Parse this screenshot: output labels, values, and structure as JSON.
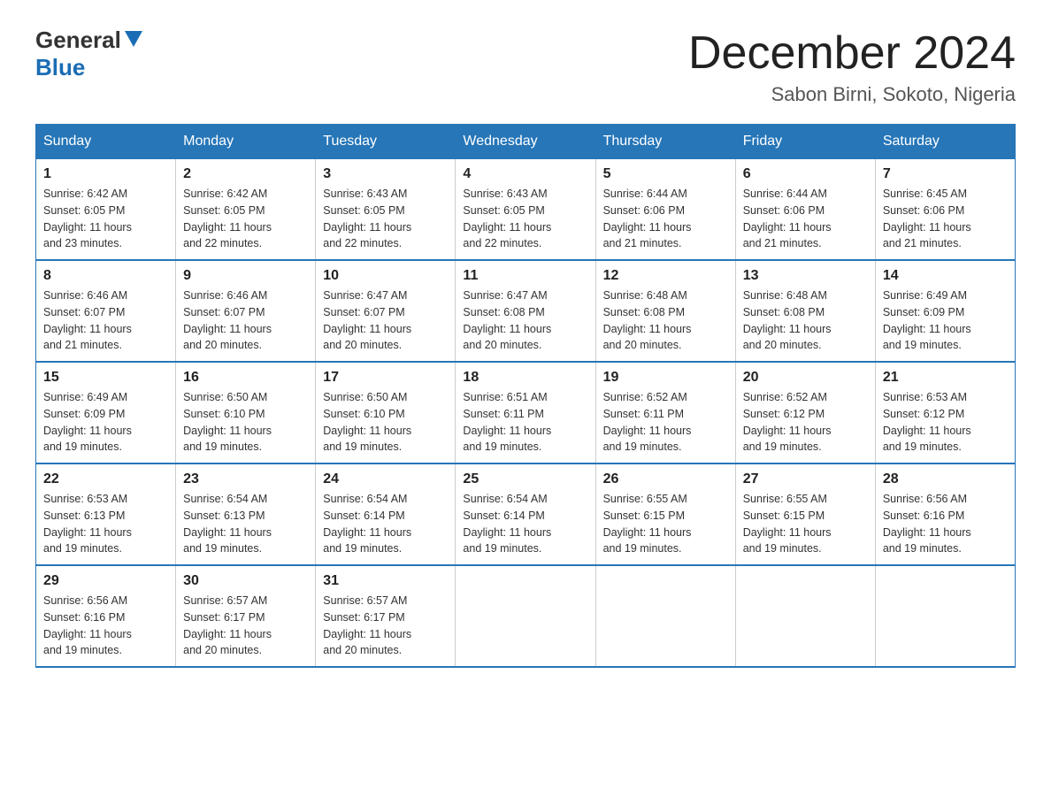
{
  "header": {
    "logo_general": "General",
    "logo_blue": "Blue",
    "month_title": "December 2024",
    "location": "Sabon Birni, Sokoto, Nigeria"
  },
  "weekdays": [
    "Sunday",
    "Monday",
    "Tuesday",
    "Wednesday",
    "Thursday",
    "Friday",
    "Saturday"
  ],
  "weeks": [
    [
      {
        "day": "1",
        "sunrise": "6:42 AM",
        "sunset": "6:05 PM",
        "daylight": "11 hours and 23 minutes."
      },
      {
        "day": "2",
        "sunrise": "6:42 AM",
        "sunset": "6:05 PM",
        "daylight": "11 hours and 22 minutes."
      },
      {
        "day": "3",
        "sunrise": "6:43 AM",
        "sunset": "6:05 PM",
        "daylight": "11 hours and 22 minutes."
      },
      {
        "day": "4",
        "sunrise": "6:43 AM",
        "sunset": "6:05 PM",
        "daylight": "11 hours and 22 minutes."
      },
      {
        "day": "5",
        "sunrise": "6:44 AM",
        "sunset": "6:06 PM",
        "daylight": "11 hours and 21 minutes."
      },
      {
        "day": "6",
        "sunrise": "6:44 AM",
        "sunset": "6:06 PM",
        "daylight": "11 hours and 21 minutes."
      },
      {
        "day": "7",
        "sunrise": "6:45 AM",
        "sunset": "6:06 PM",
        "daylight": "11 hours and 21 minutes."
      }
    ],
    [
      {
        "day": "8",
        "sunrise": "6:46 AM",
        "sunset": "6:07 PM",
        "daylight": "11 hours and 21 minutes."
      },
      {
        "day": "9",
        "sunrise": "6:46 AM",
        "sunset": "6:07 PM",
        "daylight": "11 hours and 20 minutes."
      },
      {
        "day": "10",
        "sunrise": "6:47 AM",
        "sunset": "6:07 PM",
        "daylight": "11 hours and 20 minutes."
      },
      {
        "day": "11",
        "sunrise": "6:47 AM",
        "sunset": "6:08 PM",
        "daylight": "11 hours and 20 minutes."
      },
      {
        "day": "12",
        "sunrise": "6:48 AM",
        "sunset": "6:08 PM",
        "daylight": "11 hours and 20 minutes."
      },
      {
        "day": "13",
        "sunrise": "6:48 AM",
        "sunset": "6:08 PM",
        "daylight": "11 hours and 20 minutes."
      },
      {
        "day": "14",
        "sunrise": "6:49 AM",
        "sunset": "6:09 PM",
        "daylight": "11 hours and 19 minutes."
      }
    ],
    [
      {
        "day": "15",
        "sunrise": "6:49 AM",
        "sunset": "6:09 PM",
        "daylight": "11 hours and 19 minutes."
      },
      {
        "day": "16",
        "sunrise": "6:50 AM",
        "sunset": "6:10 PM",
        "daylight": "11 hours and 19 minutes."
      },
      {
        "day": "17",
        "sunrise": "6:50 AM",
        "sunset": "6:10 PM",
        "daylight": "11 hours and 19 minutes."
      },
      {
        "day": "18",
        "sunrise": "6:51 AM",
        "sunset": "6:11 PM",
        "daylight": "11 hours and 19 minutes."
      },
      {
        "day": "19",
        "sunrise": "6:52 AM",
        "sunset": "6:11 PM",
        "daylight": "11 hours and 19 minutes."
      },
      {
        "day": "20",
        "sunrise": "6:52 AM",
        "sunset": "6:12 PM",
        "daylight": "11 hours and 19 minutes."
      },
      {
        "day": "21",
        "sunrise": "6:53 AM",
        "sunset": "6:12 PM",
        "daylight": "11 hours and 19 minutes."
      }
    ],
    [
      {
        "day": "22",
        "sunrise": "6:53 AM",
        "sunset": "6:13 PM",
        "daylight": "11 hours and 19 minutes."
      },
      {
        "day": "23",
        "sunrise": "6:54 AM",
        "sunset": "6:13 PM",
        "daylight": "11 hours and 19 minutes."
      },
      {
        "day": "24",
        "sunrise": "6:54 AM",
        "sunset": "6:14 PM",
        "daylight": "11 hours and 19 minutes."
      },
      {
        "day": "25",
        "sunrise": "6:54 AM",
        "sunset": "6:14 PM",
        "daylight": "11 hours and 19 minutes."
      },
      {
        "day": "26",
        "sunrise": "6:55 AM",
        "sunset": "6:15 PM",
        "daylight": "11 hours and 19 minutes."
      },
      {
        "day": "27",
        "sunrise": "6:55 AM",
        "sunset": "6:15 PM",
        "daylight": "11 hours and 19 minutes."
      },
      {
        "day": "28",
        "sunrise": "6:56 AM",
        "sunset": "6:16 PM",
        "daylight": "11 hours and 19 minutes."
      }
    ],
    [
      {
        "day": "29",
        "sunrise": "6:56 AM",
        "sunset": "6:16 PM",
        "daylight": "11 hours and 19 minutes."
      },
      {
        "day": "30",
        "sunrise": "6:57 AM",
        "sunset": "6:17 PM",
        "daylight": "11 hours and 20 minutes."
      },
      {
        "day": "31",
        "sunrise": "6:57 AM",
        "sunset": "6:17 PM",
        "daylight": "11 hours and 20 minutes."
      },
      null,
      null,
      null,
      null
    ]
  ],
  "labels": {
    "sunrise": "Sunrise:",
    "sunset": "Sunset:",
    "daylight": "Daylight:"
  }
}
